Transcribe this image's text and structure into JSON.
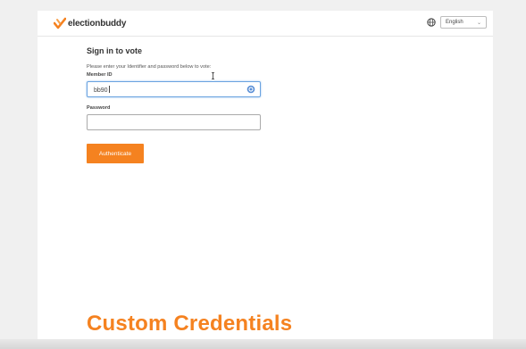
{
  "header": {
    "logo_text": "electionbuddy",
    "language": {
      "selected": "English",
      "icon": "globe-icon"
    }
  },
  "form": {
    "heading": "Sign in to vote",
    "instructions": "Please enter your Identifier and password below to vote:",
    "member_id": {
      "label": "Member ID",
      "value": "bb90",
      "icon": "autofill-icon"
    },
    "password": {
      "label": "Password",
      "value": ""
    },
    "submit_label": "Authenticate"
  },
  "caption": "Custom Credentials",
  "colors": {
    "accent": "#f58220",
    "focus_border": "#6aa3e0"
  }
}
